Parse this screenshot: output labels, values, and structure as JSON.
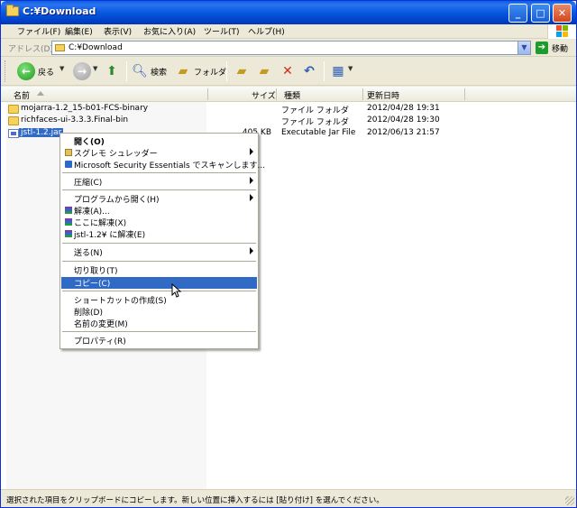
{
  "window": {
    "title": "C:¥Download"
  },
  "menubar": [
    "ファイル(F)",
    "編集(E)",
    "表示(V)",
    "お気に入り(A)",
    "ツール(T)",
    "ヘルプ(H)"
  ],
  "address": {
    "label": "アドレス(D)",
    "value": "C:¥Download",
    "go_label": "移動"
  },
  "toolbar": {
    "back_label": "戻る",
    "search_label": "検索",
    "folders_label": "フォルダ"
  },
  "columns": {
    "name": "名前",
    "size": "サイズ",
    "type": "種類",
    "date": "更新日時"
  },
  "files": [
    {
      "name": "mojarra-1.2_15-b01-FCS-binary",
      "size": "",
      "type": "ファイル フォルダ",
      "date": "2012/04/28 19:31",
      "icon": "folder-icon"
    },
    {
      "name": "richfaces-ui-3.3.3.Final-bin",
      "size": "",
      "type": "ファイル フォルダ",
      "date": "2012/04/28 19:30",
      "icon": "folder-icon"
    },
    {
      "name": "jstl-1.2.jar",
      "size": "405 KB",
      "type": "Executable Jar File",
      "date": "2012/06/13 21:57",
      "icon": "jar-file-icon"
    }
  ],
  "context_menu": {
    "open": "開く(O)",
    "shredder": "スグレモ シュレッダー",
    "mse_scan": "Microsoft Security Essentials でスキャンします...",
    "compress": "圧縮(C)",
    "open_with": "プログラムから開く(H)",
    "extract": "解凍(A)...",
    "extract_here": "ここに解凍(X)",
    "extract_to": "jstl-1.2¥ に解凍(E)",
    "send_to": "送る(N)",
    "cut": "切り取り(T)",
    "copy": "コピー(C)",
    "create_shortcut": "ショートカットの作成(S)",
    "delete": "削除(D)",
    "rename": "名前の変更(M)",
    "properties": "プロパティ(R)"
  },
  "status": {
    "text": "選択された項目をクリップボードにコピーします。新しい位置に挿入するには [貼り付け] を選んでください。"
  }
}
